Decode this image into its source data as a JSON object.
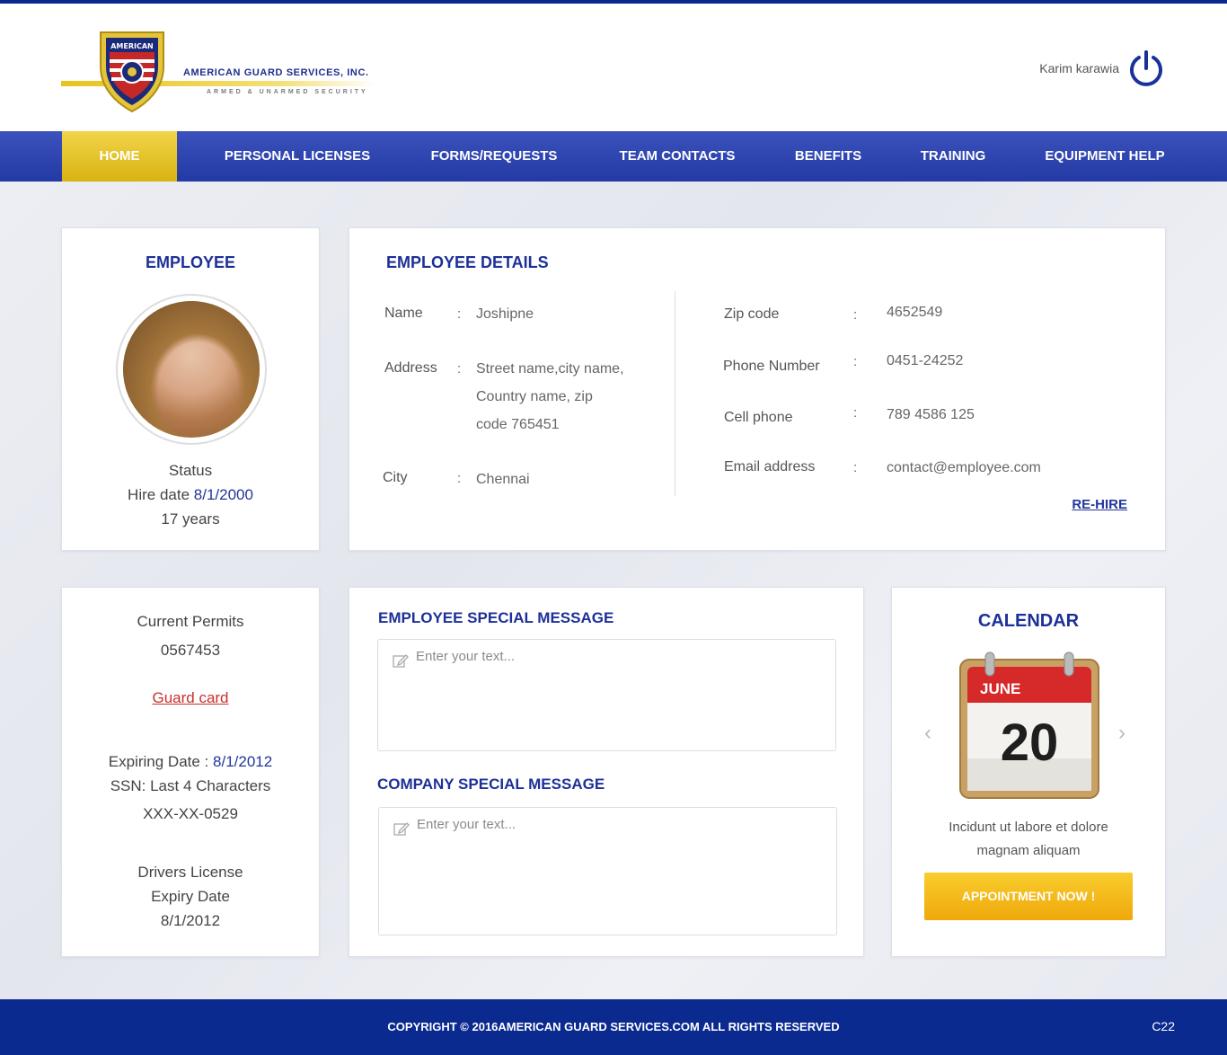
{
  "header": {
    "company_name": "AMERICAN GUARD SERVICES, INC.",
    "tagline": "ARMED & UNARMED SECURITY",
    "badge_text": "AMERICAN",
    "user_name": "Karim karawia"
  },
  "nav": {
    "items": [
      {
        "label": "HOME",
        "active": true
      },
      {
        "label": "PERSONAL LICENSES"
      },
      {
        "label": "FORMS/REQUESTS"
      },
      {
        "label": "TEAM CONTACTS"
      },
      {
        "label": "BENEFITS"
      },
      {
        "label": "TRAINING"
      },
      {
        "label": "EQUIPMENT HELP"
      }
    ]
  },
  "employee": {
    "title": "EMPLOYEE",
    "status_label": "Status",
    "hire_label": "Hire date",
    "hire_date": "8/1/2000",
    "tenure": "17 years"
  },
  "details": {
    "title": "EMPLOYEE DETAILS",
    "colon": ":",
    "name_label": "Name",
    "name": "Joshipne",
    "address_label": "Address",
    "address_lines": [
      "Street name,city name,",
      "Country name, zip",
      "code 765451"
    ],
    "city_label": "City",
    "city": "Chennai",
    "zip_label": "Zip code",
    "zip": "4652549",
    "phone_label": "Phone Number",
    "phone": "0451-24252",
    "cell_label": "Cell phone",
    "cell": "789 4586 125",
    "email_label": "Email address",
    "email": "contact@employee.com",
    "rehire": "RE-HIRE"
  },
  "permits": {
    "current_label": "Current Permits",
    "current_value": "0567453",
    "guard_card": "Guard card",
    "expiring_label": "Expiring Date :",
    "expiring_value": "8/1/2012",
    "ssn_label": "SSN: Last 4 Characters",
    "ssn_value": "XXX-XX-0529",
    "dl_label": "Drivers License",
    "dl_expiry_label": "Expiry Date",
    "dl_expiry_value": "8/1/2012"
  },
  "messages": {
    "employee_title": "EMPLOYEE SPECIAL MESSAGE",
    "employee_placeholder": "Enter your text...",
    "company_title": "COMPANY SPECIAL MESSAGE",
    "company_placeholder": "Enter your text..."
  },
  "calendar": {
    "title": "CALENDAR",
    "month": "JUNE",
    "day": "20",
    "text_line1": "Incidunt ut labore et dolore",
    "text_line2": "magnam aliquam",
    "button": "APPOINTMENT NOW !",
    "prev_arrow": "‹",
    "next_arrow": "›"
  },
  "footer": {
    "copyright": "COPYRIGHT © 2016AMERICAN GUARD SERVICES.COM ALL RIGHTS RESERVED",
    "code": "C22"
  },
  "colors": {
    "brand_blue": "#0a2a8f",
    "nav_blue": "#2f46b2",
    "accent_gold": "#e8c21c",
    "button_orange": "#f5b81a",
    "link_red": "#c9302c"
  }
}
